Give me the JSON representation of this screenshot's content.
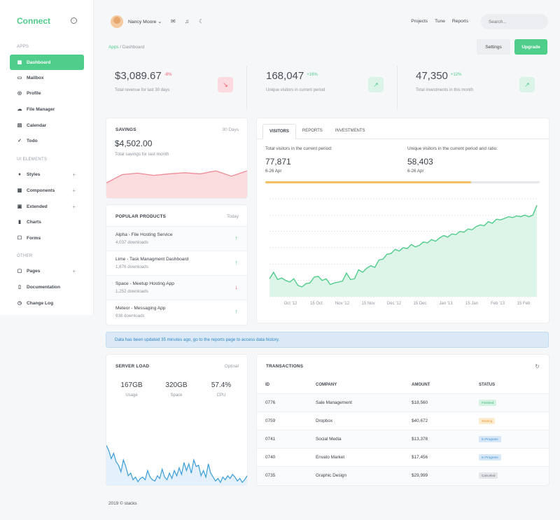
{
  "sidebar": {
    "brand": "Connect",
    "sections": [
      "APPS",
      "UI ELEMENTS",
      "OTHER"
    ],
    "apps": [
      "Dashboard",
      "Mailbox",
      "Profile",
      "File Manager",
      "Calendar",
      "Todo"
    ],
    "ui": [
      "Styles",
      "Components",
      "Extended",
      "Charts",
      "Forms"
    ],
    "other": [
      "Pages",
      "Documentation",
      "Change Log"
    ]
  },
  "topbar": {
    "user": "Nancy Moore",
    "links": [
      "Projects",
      "Tune",
      "Reports"
    ],
    "search_placeholder": "Search..."
  },
  "breadcrumb": {
    "root": "Apps",
    "sep": "/",
    "current": "Dashboard"
  },
  "actions": {
    "settings": "Settings",
    "upgrade": "Upgrade"
  },
  "kpis": [
    {
      "value": "$3,089.67",
      "change": "-8%",
      "label": "Total revenue for last 30 days",
      "color": "#ef5a6a",
      "icon": "trend-down-icon"
    },
    {
      "value": "168,047",
      "change": "+16%",
      "label": "Unique visitors in current period",
      "color": "#4fcd8b",
      "icon": "trend-up-icon"
    },
    {
      "value": "47,350",
      "change": "+12%",
      "label": "Total investments in this month",
      "color": "#4fcd8b",
      "icon": "trend-up-icon"
    }
  ],
  "savings": {
    "title": "SAVINGS",
    "period": "30 Days",
    "amount": "$4,502.00",
    "label": "Total savings for last month",
    "trend": [
      40,
      62,
      66,
      60,
      64,
      67,
      64,
      72,
      58,
      72
    ]
  },
  "products": {
    "title": "POPULAR PRODUCTS",
    "period": "Today",
    "items": [
      {
        "name": "Alpha - File Hosting Service",
        "downloads": "4,037 downloads",
        "trend": "up"
      },
      {
        "name": "Lime - Task Managment Dashboard",
        "downloads": "1,876 downloads",
        "trend": "up"
      },
      {
        "name": "Space - Meetup Hosting App",
        "downloads": "1,252 downloads",
        "trend": "down"
      },
      {
        "name": "Meteor - Messaging App",
        "downloads": "938 downloads",
        "trend": "up"
      }
    ]
  },
  "visitors": {
    "tabs": [
      "VISITORS",
      "REPORTS",
      "INVESTMENTS"
    ],
    "left_label": "Total visitors in the current period:",
    "left_value": "77,871",
    "left_range": "6-26 Apr",
    "right_label": "Unique visitors in the current period and ratio:",
    "right_value": "58,403",
    "right_range": "6-26 Apr",
    "ratio": 0.75
  },
  "chart_data": {
    "type": "area",
    "x_ticks": [
      "Oct '12",
      "15 Oct",
      "Nov '12",
      "15 Nov",
      "Dec '12",
      "15 Dec",
      "Jan '13",
      "15 Jan",
      "Feb '13",
      "15 Feb"
    ],
    "values": [
      22,
      30,
      21,
      23,
      20,
      18,
      22,
      14,
      12,
      16,
      17,
      24,
      25,
      20,
      22,
      15,
      17,
      18,
      19,
      29,
      21,
      22,
      33,
      30,
      35,
      38,
      36,
      45,
      46,
      52,
      53,
      58,
      56,
      60,
      59,
      64,
      61,
      63,
      67,
      66,
      70,
      68,
      72,
      75,
      73,
      77,
      76,
      80,
      79,
      83,
      82,
      86,
      88,
      87,
      92,
      90,
      95,
      94,
      96,
      98,
      97,
      99,
      98,
      100,
      98,
      100,
      112
    ],
    "ylim": [
      0,
      120
    ],
    "grid": true,
    "color": "#4fcd8b"
  },
  "alert": "Data has been updated 35 minutes ago, go to the reports page to access data history.",
  "server": {
    "title": "SERVER LOAD",
    "option": "Optinal",
    "stats": [
      {
        "value": "167GB",
        "label": "Usage"
      },
      {
        "value": "320GB",
        "label": "Space"
      },
      {
        "value": "57.4%",
        "label": "CPU"
      }
    ],
    "load": [
      60,
      52,
      40,
      48,
      35,
      30,
      20,
      38,
      28,
      14,
      18,
      8,
      12,
      5,
      10,
      12,
      8,
      22,
      12,
      8,
      6,
      14,
      10,
      24,
      12,
      8,
      18,
      10,
      22,
      14,
      26,
      16,
      34,
      22,
      32,
      18,
      38,
      28,
      30,
      14,
      22,
      12,
      32,
      18,
      12,
      6,
      10,
      4,
      12,
      8,
      14,
      10,
      16,
      12,
      6,
      10,
      4,
      8,
      14
    ]
  },
  "transactions": {
    "title": "TRANSACTIONS",
    "headers": [
      "ID",
      "COMPANY",
      "AMOUNT",
      "STATUS"
    ],
    "rows": [
      {
        "id": "0776",
        "company": "Sale Management",
        "amount": "$18,560",
        "status": "Finished",
        "bg": "#d4f3e3",
        "fg": "#3cb87a"
      },
      {
        "id": "0759",
        "company": "Dropbox",
        "amount": "$40,672",
        "status": "Waiting",
        "bg": "#fdebd0",
        "fg": "#e89a3b"
      },
      {
        "id": "0741",
        "company": "Social Media",
        "amount": "$13,378",
        "status": "In Progress",
        "bg": "#d6e8f8",
        "fg": "#3b8ed0"
      },
      {
        "id": "0740",
        "company": "Envato Market",
        "amount": "$17,456",
        "status": "In Progress",
        "bg": "#d6e8f8",
        "fg": "#3b8ed0"
      },
      {
        "id": "0735",
        "company": "Graphic Design",
        "amount": "$29,999",
        "status": "Canceled",
        "bg": "#e4e6ea",
        "fg": "#6b7078"
      }
    ]
  },
  "footer": "2019 © stacks"
}
